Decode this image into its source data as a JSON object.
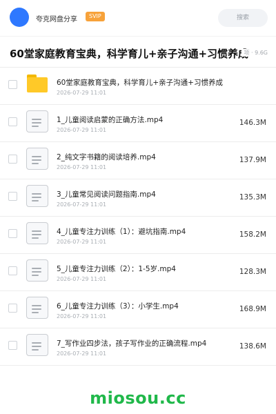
{
  "header": {
    "share_name": "夸克网盘分享",
    "svip_badge": "SVIP",
    "search_label": "搜索"
  },
  "page": {
    "title": "60堂家庭教育宝典，科学育儿+亲子沟通+习惯养成",
    "meta": "项 · 9.6G"
  },
  "files": [
    {
      "name": "60堂家庭教育宝典，科学育儿+亲子沟通+习惯养成",
      "date": "2026-07-29 11:01",
      "size": "",
      "type": "folder"
    },
    {
      "name": "1_儿童阅读启蒙的正确方法.mp4",
      "date": "2026-07-29 11:01",
      "size": "146.3M",
      "type": "file"
    },
    {
      "name": "2_纯文字书籍的阅读培养.mp4",
      "date": "2026-07-29 11:01",
      "size": "137.9M",
      "type": "file"
    },
    {
      "name": "3_儿童常见阅读问题指南.mp4",
      "date": "2026-07-29 11:01",
      "size": "135.3M",
      "type": "file"
    },
    {
      "name": "4_儿童专注力训练（1）：避坑指南.mp4",
      "date": "2026-07-29 11:01",
      "size": "158.2M",
      "type": "file"
    },
    {
      "name": "5_儿童专注力训练（2）：1-5岁.mp4",
      "date": "2026-07-29 11:01",
      "size": "128.3M",
      "type": "file"
    },
    {
      "name": "6_儿童专注力训练（3）：小学生.mp4",
      "date": "2026-07-29 11:01",
      "size": "168.9M",
      "type": "file"
    },
    {
      "name": "7_写作业四步法，孩子写作业的正确流程.mp4",
      "date": "2026-07-29 11:01",
      "size": "138.6M",
      "type": "file"
    }
  ],
  "watermark": "miosou.cc",
  "colors": {
    "accent": "#2e78ff",
    "svip": "#f7a23a",
    "folder": "#ffc928",
    "watermark": "#20b84a"
  }
}
